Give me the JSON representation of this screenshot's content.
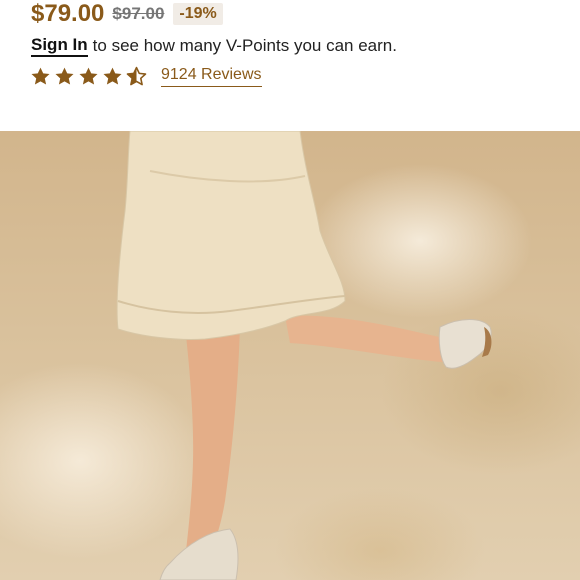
{
  "price": {
    "current": "$79.00",
    "original": "$97.00",
    "discount": "-19%"
  },
  "points": {
    "signin_label": "Sign In",
    "message": "to see how many V-Points you can earn."
  },
  "rating": {
    "stars": 4.5,
    "max_stars": 5,
    "reviews_label": "9124 Reviews"
  },
  "colors": {
    "accent": "#8a5a1a",
    "strike": "#767676"
  },
  "hero": {
    "icon": "product-photo"
  }
}
